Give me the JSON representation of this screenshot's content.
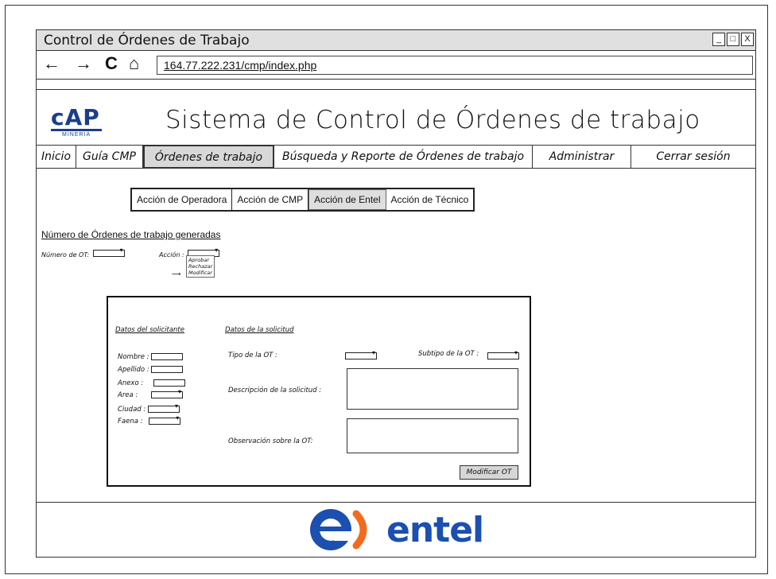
{
  "window": {
    "title": "Control de Órdenes de Trabajo",
    "controls": [
      "_",
      "□",
      "X"
    ]
  },
  "browser": {
    "back_icon": "←",
    "forward_icon": "→",
    "reload_icon": "C",
    "home_icon": "⌂",
    "url": "164.77.222.231/cmp/index.php"
  },
  "header": {
    "logo_text": "cAP",
    "logo_sub": "MINERIA",
    "app_title": "Sistema de Control de Órdenes de trabajo"
  },
  "menu": [
    {
      "label": "Inicio"
    },
    {
      "label": "Guía CMP"
    },
    {
      "label": "Órdenes de trabajo"
    },
    {
      "label": "Búsqueda y Reporte de Órdenes de trabajo"
    },
    {
      "label": "Administrar"
    },
    {
      "label": "Cerrar sesión"
    }
  ],
  "tabs": [
    {
      "label": "Acción de Operadora"
    },
    {
      "label": "Acción de CMP"
    },
    {
      "label": "Acción de Entel"
    },
    {
      "label": "Acción de Técnico"
    }
  ],
  "section_title": "Número de Órdenes de trabajo generadas",
  "ot_number_label": "Número de OT:",
  "action_label": "Acción :",
  "action_options": [
    "Aprobar",
    "Rechazar",
    "Modificar"
  ],
  "arrow": "⟶",
  "form": {
    "requester_heading": "Datos del solicitante",
    "request_heading": "Datos de la solicitud",
    "fields": {
      "nombre": "Nombre :",
      "apellido": "Apellido :",
      "anexo": "Anexo :",
      "area": "Area :",
      "ciudad": "Ciudad :",
      "faena": "Faena :"
    },
    "tipo_ot": "Tipo de la OT :",
    "subtipo_ot": "Subtipo de la OT :",
    "descripcion": "Descripción de la solicitud :",
    "observacion": "Observación sobre la OT:",
    "submit": "Modificar OT"
  },
  "footer": {
    "brand": "entel",
    "brand_color": "#1b4fb0",
    "accent_color": "#f26b1d"
  }
}
